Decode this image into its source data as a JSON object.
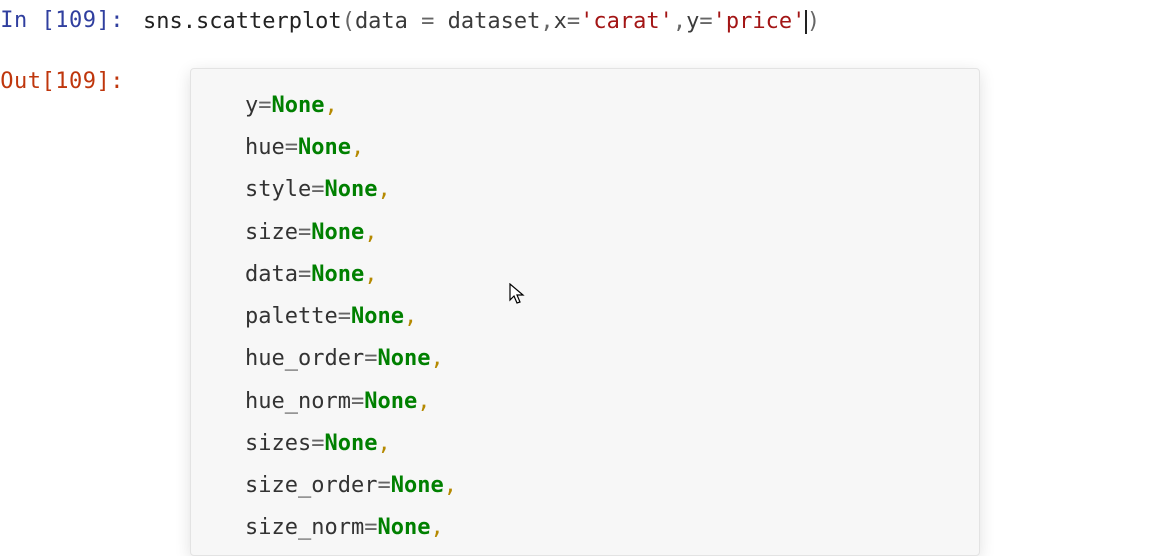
{
  "cell": {
    "in_prompt": "In [109]:",
    "out_prompt": "Out[109]:",
    "code": {
      "prefix": "sns.scatterplot",
      "paren_open": "(",
      "arg1_name": "data",
      "eq": " = ",
      "arg1_val": "dataset",
      "sep": ",",
      "arg2_name": "x",
      "arg2_eq": "=",
      "arg2_val": "'carat'",
      "arg3_name": "y",
      "arg3_eq": "=",
      "arg3_val": "'price'",
      "paren_close": ")"
    }
  },
  "tooltip": {
    "params": [
      {
        "name": "y",
        "default": "None"
      },
      {
        "name": "hue",
        "default": "None"
      },
      {
        "name": "style",
        "default": "None"
      },
      {
        "name": "size",
        "default": "None"
      },
      {
        "name": "data",
        "default": "None"
      },
      {
        "name": "palette",
        "default": "None"
      },
      {
        "name": "hue_order",
        "default": "None"
      },
      {
        "name": "hue_norm",
        "default": "None"
      },
      {
        "name": "sizes",
        "default": "None"
      },
      {
        "name": "size_order",
        "default": "None"
      },
      {
        "name": "size_norm",
        "default": "None"
      }
    ]
  }
}
